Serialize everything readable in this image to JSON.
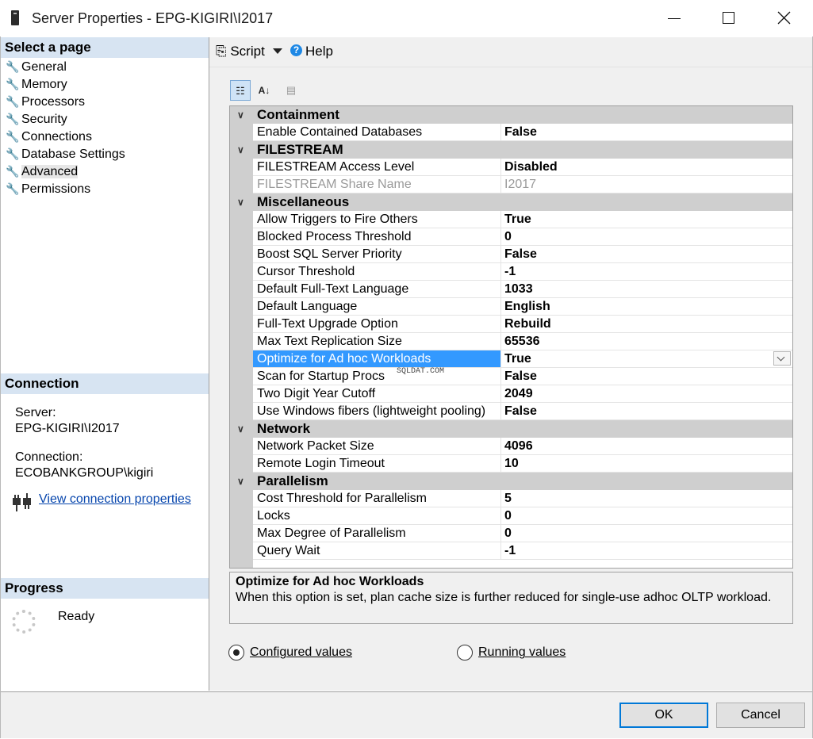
{
  "window": {
    "title": "Server Properties - EPG-KIGIRI\\I2017",
    "icon": "server-icon",
    "controls": [
      "minimize-icon",
      "maximize-icon",
      "close-icon"
    ]
  },
  "left": {
    "select_page_header": "Select a page",
    "pages": [
      {
        "label": "General",
        "icon": "wrench-icon"
      },
      {
        "label": "Memory",
        "icon": "wrench-icon"
      },
      {
        "label": "Processors",
        "icon": "wrench-icon"
      },
      {
        "label": "Security",
        "icon": "wrench-icon"
      },
      {
        "label": "Connections",
        "icon": "wrench-icon"
      },
      {
        "label": "Database Settings",
        "icon": "wrench-icon"
      },
      {
        "label": "Advanced",
        "icon": "wrench-icon",
        "selected": true
      },
      {
        "label": "Permissions",
        "icon": "wrench-icon"
      }
    ],
    "connection_header": "Connection",
    "server_label": "Server:",
    "server_value": "EPG-KIGIRI\\I2017",
    "connection_label": "Connection:",
    "connection_value": "ECOBANKGROUP\\kigiri",
    "view_connection_link": "View connection properties",
    "progress_header": "Progress",
    "progress_status": "Ready"
  },
  "toolbar": {
    "script_label": "Script",
    "help_label": "Help"
  },
  "grid": {
    "categories": [
      {
        "name": "Containment",
        "rows": [
          {
            "name": "Enable Contained Databases",
            "value": "False"
          }
        ]
      },
      {
        "name": "FILESTREAM",
        "rows": [
          {
            "name": "FILESTREAM Access Level",
            "value": "Disabled"
          },
          {
            "name": "FILESTREAM Share Name",
            "value": "I2017",
            "disabled": true
          }
        ]
      },
      {
        "name": "Miscellaneous",
        "rows": [
          {
            "name": "Allow Triggers to Fire Others",
            "value": "True"
          },
          {
            "name": "Blocked Process Threshold",
            "value": "0"
          },
          {
            "name": "Boost SQL Server Priority",
            "value": "False"
          },
          {
            "name": "Cursor Threshold",
            "value": "-1"
          },
          {
            "name": "Default Full-Text Language",
            "value": "1033"
          },
          {
            "name": "Default Language",
            "value": "English"
          },
          {
            "name": "Full-Text Upgrade Option",
            "value": "Rebuild"
          },
          {
            "name": "Max Text Replication Size",
            "value": "65536"
          },
          {
            "name": "Optimize for Ad hoc Workloads",
            "value": "True",
            "selected": true
          },
          {
            "name": "Scan for Startup Procs",
            "value": "False"
          },
          {
            "name": "Two Digit Year Cutoff",
            "value": "2049"
          },
          {
            "name": "Use Windows fibers (lightweight pooling)",
            "value": "False"
          }
        ]
      },
      {
        "name": "Network",
        "rows": [
          {
            "name": "Network Packet Size",
            "value": "4096"
          },
          {
            "name": "Remote Login Timeout",
            "value": "10"
          }
        ]
      },
      {
        "name": "Parallelism",
        "rows": [
          {
            "name": "Cost Threshold for Parallelism",
            "value": "5"
          },
          {
            "name": "Locks",
            "value": "0"
          },
          {
            "name": "Max Degree of Parallelism",
            "value": "0"
          },
          {
            "name": "Query Wait",
            "value": "-1"
          }
        ]
      }
    ],
    "watermark": "SQLDAT.COM"
  },
  "description": {
    "title": "Optimize for Ad hoc Workloads",
    "text": "When this option is set, plan cache size is further reduced for single-use adhoc OLTP workload."
  },
  "options": {
    "configured_label": "Configured values",
    "running_label": "Running values",
    "selected": "configured"
  },
  "footer": {
    "ok_label": "OK",
    "cancel_label": "Cancel"
  },
  "colors": {
    "selection": "#3399ff",
    "section_header": "#d7e4f2",
    "category_row": "#cfcfcf",
    "link": "#0645ad"
  }
}
